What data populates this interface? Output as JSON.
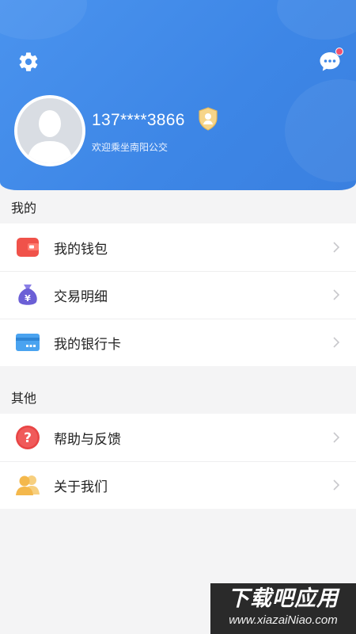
{
  "header": {
    "phone": "137****3866",
    "welcome": "欢迎乘坐南阳公交"
  },
  "sections": {
    "mine": {
      "title": "我的",
      "items": [
        {
          "label": "我的钱包",
          "icon": "wallet-icon"
        },
        {
          "label": "交易明细",
          "icon": "money-bag-icon"
        },
        {
          "label": "我的银行卡",
          "icon": "bank-card-icon"
        }
      ]
    },
    "other": {
      "title": "其他",
      "items": [
        {
          "label": "帮助与反馈",
          "icon": "help-icon"
        },
        {
          "label": "关于我们",
          "icon": "users-icon"
        }
      ]
    }
  },
  "watermark": {
    "title": "下载吧应用",
    "url": "www.xiazaiNiao.com"
  },
  "colors": {
    "header_blue": "#4a93ee",
    "background": "#f4f4f5",
    "wallet_red": "#f0524a",
    "bag_purple": "#6b5fd6",
    "card_blue": "#4aa3f0",
    "help_red": "#e84545",
    "users_yellow": "#f4c064"
  }
}
